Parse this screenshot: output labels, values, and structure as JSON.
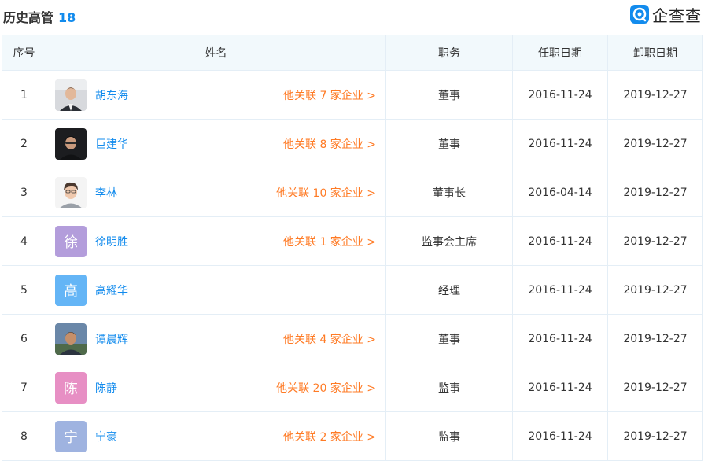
{
  "header": {
    "title": "历史高管",
    "count": "18",
    "brand": "企查查"
  },
  "table": {
    "columns": {
      "index": "序号",
      "name": "姓名",
      "position": "职务",
      "start": "任职日期",
      "end": "卸职日期"
    },
    "rows": [
      {
        "index": "1",
        "name": "胡东海",
        "related": "他关联 7 家企业 >",
        "position": "董事",
        "start": "2016-11-24",
        "end": "2019-12-27",
        "avatar": {
          "type": "photo",
          "icon": "person-photo-icon"
        }
      },
      {
        "index": "2",
        "name": "巨建华",
        "related": "他关联 8 家企业 >",
        "position": "董事",
        "start": "2016-11-24",
        "end": "2019-12-27",
        "avatar": {
          "type": "photo",
          "icon": "person-photo-icon"
        }
      },
      {
        "index": "3",
        "name": "李林",
        "related": "他关联 10 家企业 >",
        "position": "董事长",
        "start": "2016-04-14",
        "end": "2019-12-27",
        "avatar": {
          "type": "photo",
          "icon": "person-photo-icon"
        }
      },
      {
        "index": "4",
        "name": "徐明胜",
        "related": "他关联 1 家企业 >",
        "position": "监事会主席",
        "start": "2016-11-24",
        "end": "2019-12-27",
        "avatar": {
          "type": "char",
          "char": "徐",
          "color": "#b39ddb"
        }
      },
      {
        "index": "5",
        "name": "高耀华",
        "related": "",
        "position": "经理",
        "start": "2016-11-24",
        "end": "2019-12-27",
        "avatar": {
          "type": "char",
          "char": "高",
          "color": "#64b5f6"
        }
      },
      {
        "index": "6",
        "name": "谭晨辉",
        "related": "他关联 4 家企业 >",
        "position": "董事",
        "start": "2016-11-24",
        "end": "2019-12-27",
        "avatar": {
          "type": "photo",
          "icon": "person-photo-icon"
        }
      },
      {
        "index": "7",
        "name": "陈静",
        "related": "他关联 20 家企业 >",
        "position": "监事",
        "start": "2016-11-24",
        "end": "2019-12-27",
        "avatar": {
          "type": "char",
          "char": "陈",
          "color": "#e78fc4"
        }
      },
      {
        "index": "8",
        "name": "宁豪",
        "related": "他关联 2 家企业 >",
        "position": "监事",
        "start": "2016-11-24",
        "end": "2019-12-27",
        "avatar": {
          "type": "char",
          "char": "宁",
          "color": "#9fb3e0"
        }
      }
    ]
  },
  "colors": {
    "accent": "#128bed",
    "related": "#ff6400",
    "header_bg": "#f2f9fc",
    "border": "#e4eef6"
  }
}
